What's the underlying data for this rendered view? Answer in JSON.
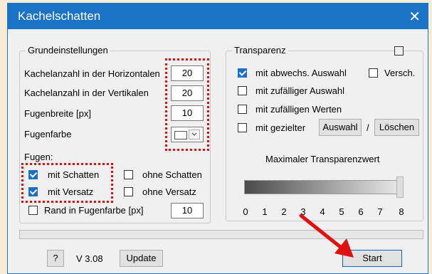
{
  "window": {
    "title": "Kachelschatten",
    "close_symbol": "✕"
  },
  "basic": {
    "legend": "Grundeinstellungen",
    "rows": [
      {
        "label": "Kachelanzahl in der Horizontalen",
        "value": "20"
      },
      {
        "label": "Kachelanzahl in der Vertikalen",
        "value": "20"
      },
      {
        "label": "Fugenbreite [px]",
        "value": "10"
      }
    ],
    "color_label": "Fugenfarbe",
    "joints_label": "Fugen:",
    "shadow_with": "mit Schatten",
    "shadow_without": "ohne Schatten",
    "offset_with": "mit Versatz",
    "offset_without": "ohne Versatz",
    "border_label": "Rand in Fugenfarbe [px]",
    "border_value": "10"
  },
  "transparency": {
    "legend": "Transparenz",
    "alt_selection": "mit abwechs. Auswahl",
    "shift": "Versch.",
    "random_selection": "mit zufälliger Auswahl",
    "random_values": "mit zufälligen Werten",
    "targeted": "mit gezielter",
    "select_button": "Auswahl",
    "slash": "/",
    "delete_button": "Löschen",
    "max_label": "Maximaler Transparenzwert",
    "slider_value": 8,
    "ticks": [
      "0",
      "1",
      "2",
      "3",
      "4",
      "5",
      "6",
      "7",
      "8"
    ]
  },
  "footer": {
    "help": "?",
    "version": "V 3.08",
    "update": "Update",
    "start": "Start"
  },
  "colors": {
    "title_bar": "#1a73c4",
    "annotation": "#e01010",
    "checkbox_checked": "#1a6fc9"
  }
}
